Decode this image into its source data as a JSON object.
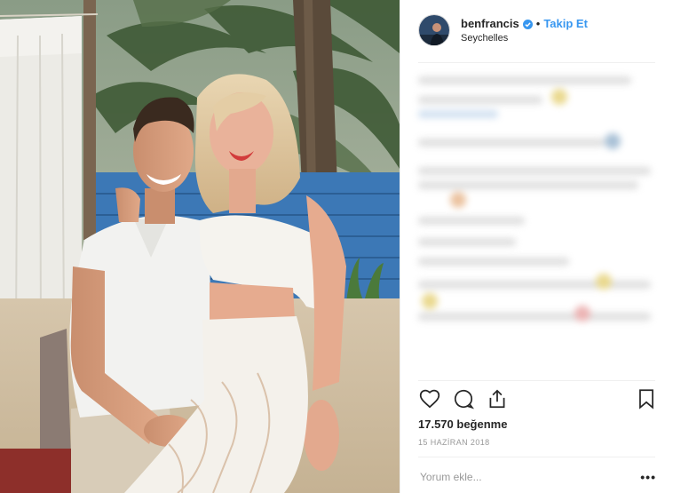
{
  "header": {
    "username": "benfrancis",
    "separator": "•",
    "follow_label": "Takip Et",
    "location": "Seychelles",
    "verified_color": "#3897f0"
  },
  "photo": {
    "description_icon": "couple-beach-photo"
  },
  "actions": {
    "like_icon": "heart-outline-icon",
    "comment_icon": "comment-bubble-icon",
    "share_icon": "share-upload-icon",
    "save_icon": "bookmark-icon"
  },
  "likes_text": "17.570 beğenme",
  "date_text": "15 HAZİRAN 2018",
  "comment": {
    "placeholder": "Yorum ekle...",
    "more_label": "•••"
  },
  "colors": {
    "accent": "#3897f0",
    "text": "#262626",
    "muted": "#999999",
    "divider": "#efefef"
  }
}
